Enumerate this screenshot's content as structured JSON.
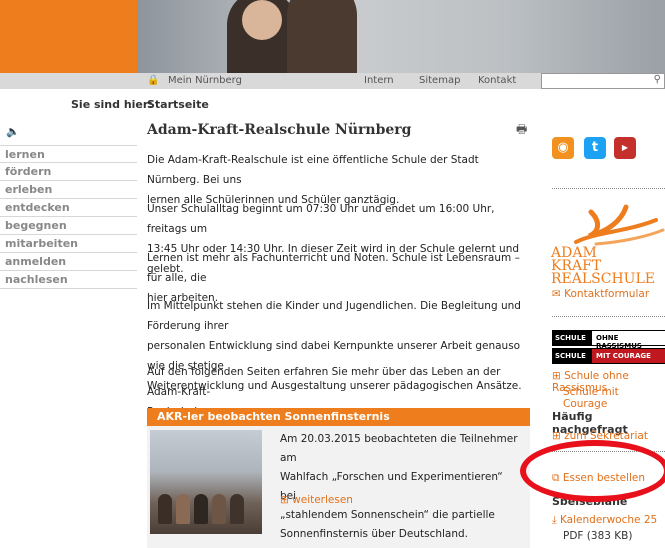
{
  "header": {
    "topbar": {
      "mein": "Mein Nürnberg",
      "intern": "Intern",
      "sitemap": "Sitemap",
      "kontakt": "Kontakt"
    },
    "search": {
      "placeholder": ""
    }
  },
  "breadcrumb": {
    "label": "Sie sind hier:",
    "value": "Startseite"
  },
  "nav": [
    "lernen",
    "fördern",
    "erleben",
    "entdecken",
    "begegnen",
    "mitarbeiten",
    "anmelden",
    "nachlesen"
  ],
  "main": {
    "title": "Adam-Kraft-Realschule Nürnberg",
    "paragraphs": [
      [
        "Die Adam-Kraft-Realschule ist eine öffentliche Schule der Stadt Nürnberg. Bei uns",
        "lernen alle Schülerinnen und Schüler ganztägig."
      ],
      [
        "Unser Schulalltag beginnt um 07:30 Uhr und endet um 16:00 Uhr, freitags um",
        "13:45 Uhr oder 14:30 Uhr. In dieser Zeit wird in der Schule gelernt und gelebt."
      ],
      [
        "Lernen ist mehr als Fachunterricht und Noten. Schule ist Lebensraum – für alle, die",
        "hier arbeiten."
      ],
      [
        "Im Mittelpunkt stehen die Kinder und Jugendlichen. Die Begleitung und Förderung ihrer",
        "personalen Entwicklung sind dabei Kernpunkte unserer Arbeit genauso wie die stetige",
        "Weiterentwicklung und Ausgestaltung unserer pädagogischen Ansätze."
      ],
      [
        "Auf den folgenden Seiten erfahren Sie mehr über das Leben an der Adam-Kraft-",
        "Realschule."
      ]
    ],
    "teaser": {
      "heading": "AKR-ler beobachten Sonnenfinsternis",
      "lines": [
        "Am 20.03.2015 beobachteten die Teilnehmer am",
        "Wahlfach „Forschen und Experimentieren“ bei",
        "„stahlendem Sonnenschein“ die partielle",
        "Sonnenfinsternis über Deutschland."
      ],
      "more": "weiterlesen"
    }
  },
  "sidebar": {
    "logo_lines": [
      "ADAM",
      "KRAFT",
      "REALSCHULE"
    ],
    "kontakt": "Kontaktformular",
    "banner": {
      "row1_left": "SCHULE",
      "row1_right": "OHNE RASSISMUS",
      "row2_left": "SCHULE",
      "row2_right": "MIT COURAGE"
    },
    "courage_link_1": "Schule ohne Rassismus",
    "courage_link_2": "Schule mit Courage",
    "faq_heading": "Häufig nachgefragt",
    "sekretariat": "zum Sekretariat",
    "essen": "Essen bestellen",
    "speiseplaene": "Speisepläne",
    "kalender": "Kalenderwoche 25",
    "pdf": "PDF (383 KB)"
  },
  "colors": {
    "accent": "#ee7d1d",
    "annotation": "#e8101a"
  }
}
